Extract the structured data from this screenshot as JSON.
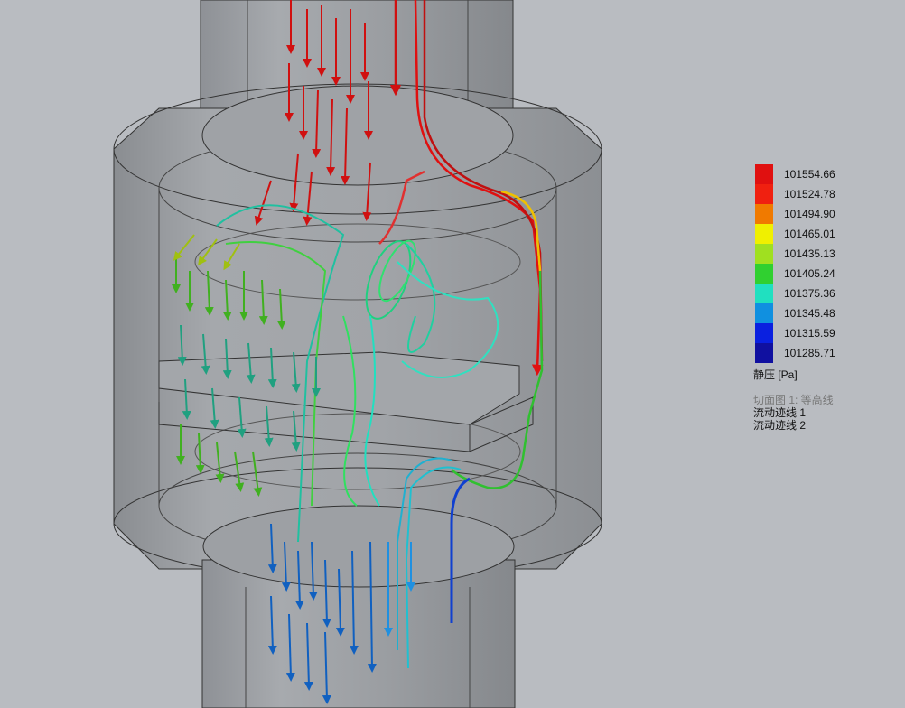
{
  "legend": {
    "unit_label": "静压 [Pa]",
    "values": [
      "101554.66",
      "101524.78",
      "101494.90",
      "101465.01",
      "101435.13",
      "101405.24",
      "101375.36",
      "101345.48",
      "101315.59",
      "101285.71"
    ],
    "colors": [
      "#e01010",
      "#f02010",
      "#f07a00",
      "#f0f000",
      "#a0e020",
      "#30d030",
      "#20e0c0",
      "#1090e0",
      "#0a20e0",
      "#1010a0"
    ]
  },
  "plots": [
    {
      "label": "切面图 1: 等高线",
      "state": "hidden"
    },
    {
      "label": "流动迹线 1",
      "state": "shown"
    },
    {
      "label": "流动迹线 2",
      "state": "shown"
    }
  ]
}
